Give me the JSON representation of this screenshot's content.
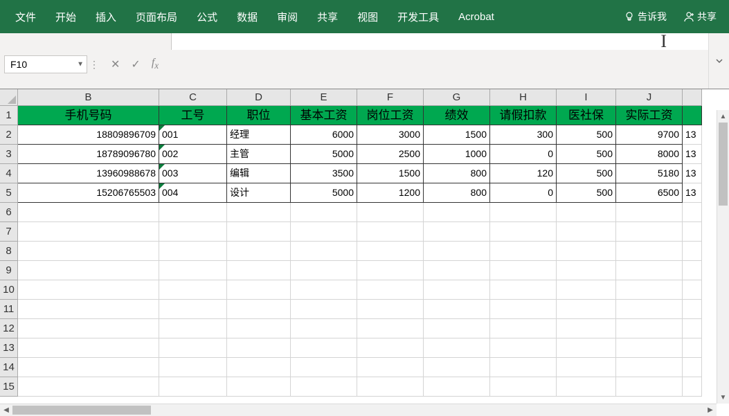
{
  "ribbon": {
    "tabs": [
      "文件",
      "开始",
      "插入",
      "页面布局",
      "公式",
      "数据",
      "审阅",
      "共享",
      "视图",
      "开发工具",
      "Acrobat"
    ],
    "tell_me": "告诉我",
    "share": "共享"
  },
  "namebox": {
    "value": "F10"
  },
  "formula": {
    "value": ""
  },
  "columns": [
    "B",
    "C",
    "D",
    "E",
    "F",
    "G",
    "H",
    "I",
    "J"
  ],
  "row_numbers": [
    1,
    2,
    3,
    4,
    5,
    6,
    7,
    8,
    9,
    10,
    11,
    12,
    13,
    14,
    15
  ],
  "headers": {
    "B": "手机号码",
    "C": "工号",
    "D": "职位",
    "E": "基本工资",
    "F": "岗位工资",
    "G": "绩效",
    "H": "请假扣款",
    "I": "医社保",
    "J": "实际工资"
  },
  "rows": [
    {
      "B": "18809896709",
      "C": "001",
      "D": "经理",
      "E": "6000",
      "F": "3000",
      "G": "1500",
      "H": "300",
      "I": "500",
      "J": "9700",
      "K": "13"
    },
    {
      "B": "18789096780",
      "C": "002",
      "D": "主管",
      "E": "5000",
      "F": "2500",
      "G": "1000",
      "H": "0",
      "I": "500",
      "J": "8000",
      "K": "13"
    },
    {
      "B": "13960988678",
      "C": "003",
      "D": "编辑",
      "E": "3500",
      "F": "1500",
      "G": "800",
      "H": "120",
      "I": "500",
      "J": "5180",
      "K": "13"
    },
    {
      "B": "15206765503",
      "C": "004",
      "D": "设计",
      "E": "5000",
      "F": "1200",
      "G": "800",
      "H": "0",
      "I": "500",
      "J": "6500",
      "K": "13"
    }
  ]
}
